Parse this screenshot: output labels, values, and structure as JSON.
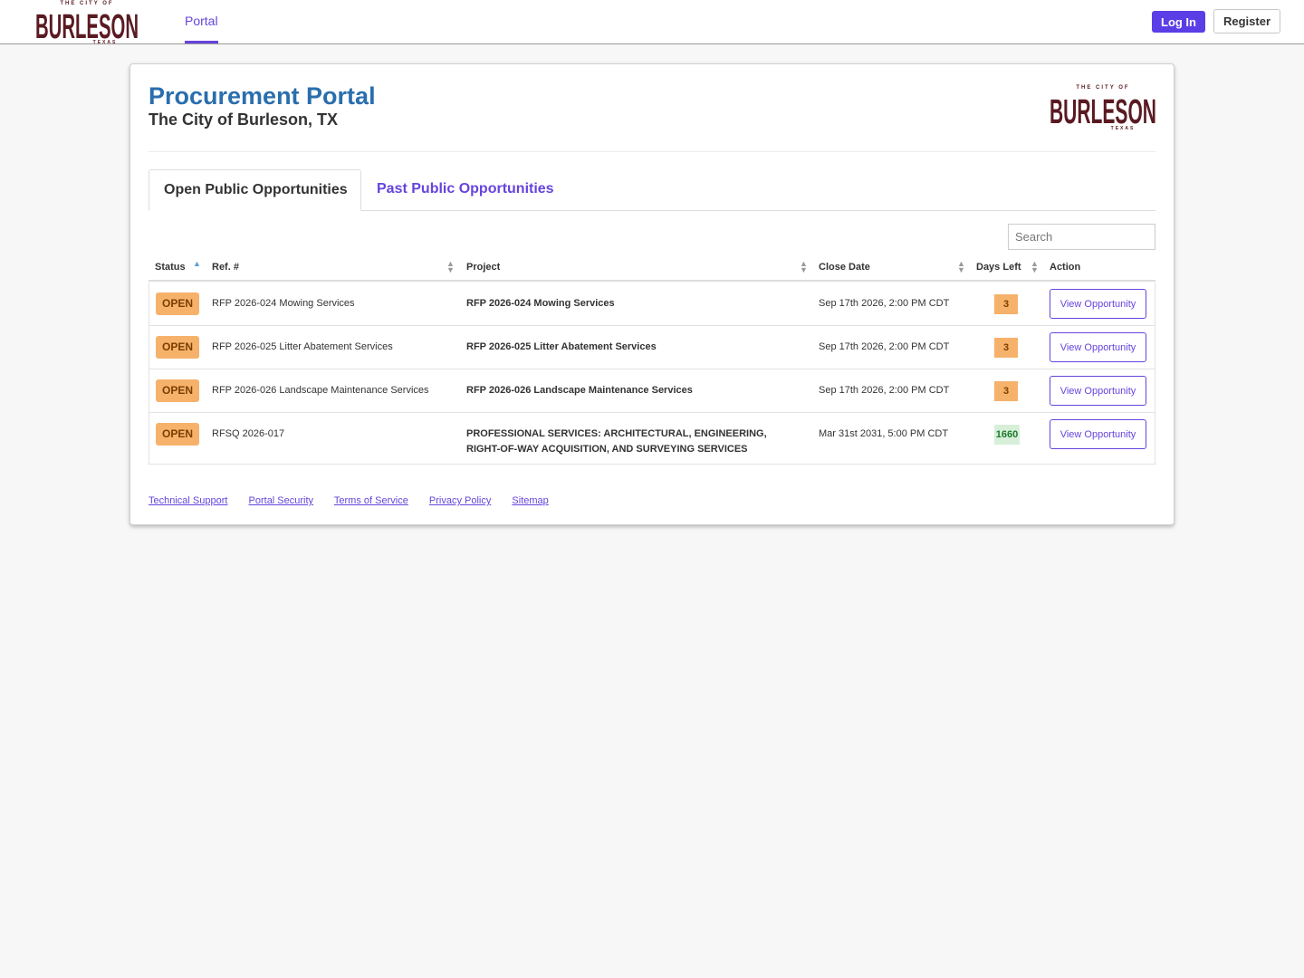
{
  "nav": {
    "logo_small": "THE CITY OF",
    "logo_main": "BURLESON",
    "logo_sub": "TEXAS",
    "portal_label": "Portal",
    "login_label": "Log In",
    "register_label": "Register"
  },
  "header": {
    "title": "Procurement Portal",
    "subtitle": "The City of Burleson, TX"
  },
  "tabs": [
    {
      "label": "Open Public Opportunities",
      "active": true
    },
    {
      "label": "Past Public Opportunities",
      "active": false
    }
  ],
  "search": {
    "placeholder": "Search",
    "value": ""
  },
  "table": {
    "columns": [
      "Status",
      "Ref. #",
      "Project",
      "Close Date",
      "Days Left",
      "Action"
    ],
    "rows": [
      {
        "status": "OPEN",
        "ref": "RFP 2026-024 Mowing Services",
        "project": "RFP 2026-024 Mowing Services",
        "close_date": "Sep 17th 2026, 2:00 PM CDT",
        "days_left": "3",
        "action": "View Opportunity"
      },
      {
        "status": "OPEN",
        "ref": "RFP 2026-025 Litter Abatement Services",
        "project": "RFP 2026-025 Litter Abatement Services",
        "close_date": "Sep 17th 2026, 2:00 PM CDT",
        "days_left": "3",
        "action": "View Opportunity"
      },
      {
        "status": "OPEN",
        "ref": "RFP 2026-026 Landscape Maintenance Services",
        "project": "RFP 2026-026 Landscape Maintenance Services",
        "close_date": "Sep 17th 2026, 2:00 PM CDT",
        "days_left": "3",
        "action": "View Opportunity"
      },
      {
        "status": "OPEN",
        "ref": "RFSQ 2026-017",
        "project_line1": "PROFESSIONAL SERVICES: ARCHITECTURAL, ENGINEERING,",
        "project_line2": "RIGHT-OF-WAY ACQUISITION, AND SURVEYING SERVICES",
        "close_date": "Mar 31st 2031, 5:00 PM CDT",
        "days_left": "1660",
        "action": "View Opportunity"
      }
    ]
  },
  "footer": {
    "links": [
      "Technical Support",
      "Portal Security",
      "Terms of Service",
      "Privacy Policy",
      "Sitemap"
    ]
  },
  "colors": {
    "accent": "#6644dd",
    "title_blue": "#2a6ead",
    "logo_maroon": "#5a1a22",
    "open_badge": "#f6b26b",
    "days_green": "#d7efd9"
  }
}
